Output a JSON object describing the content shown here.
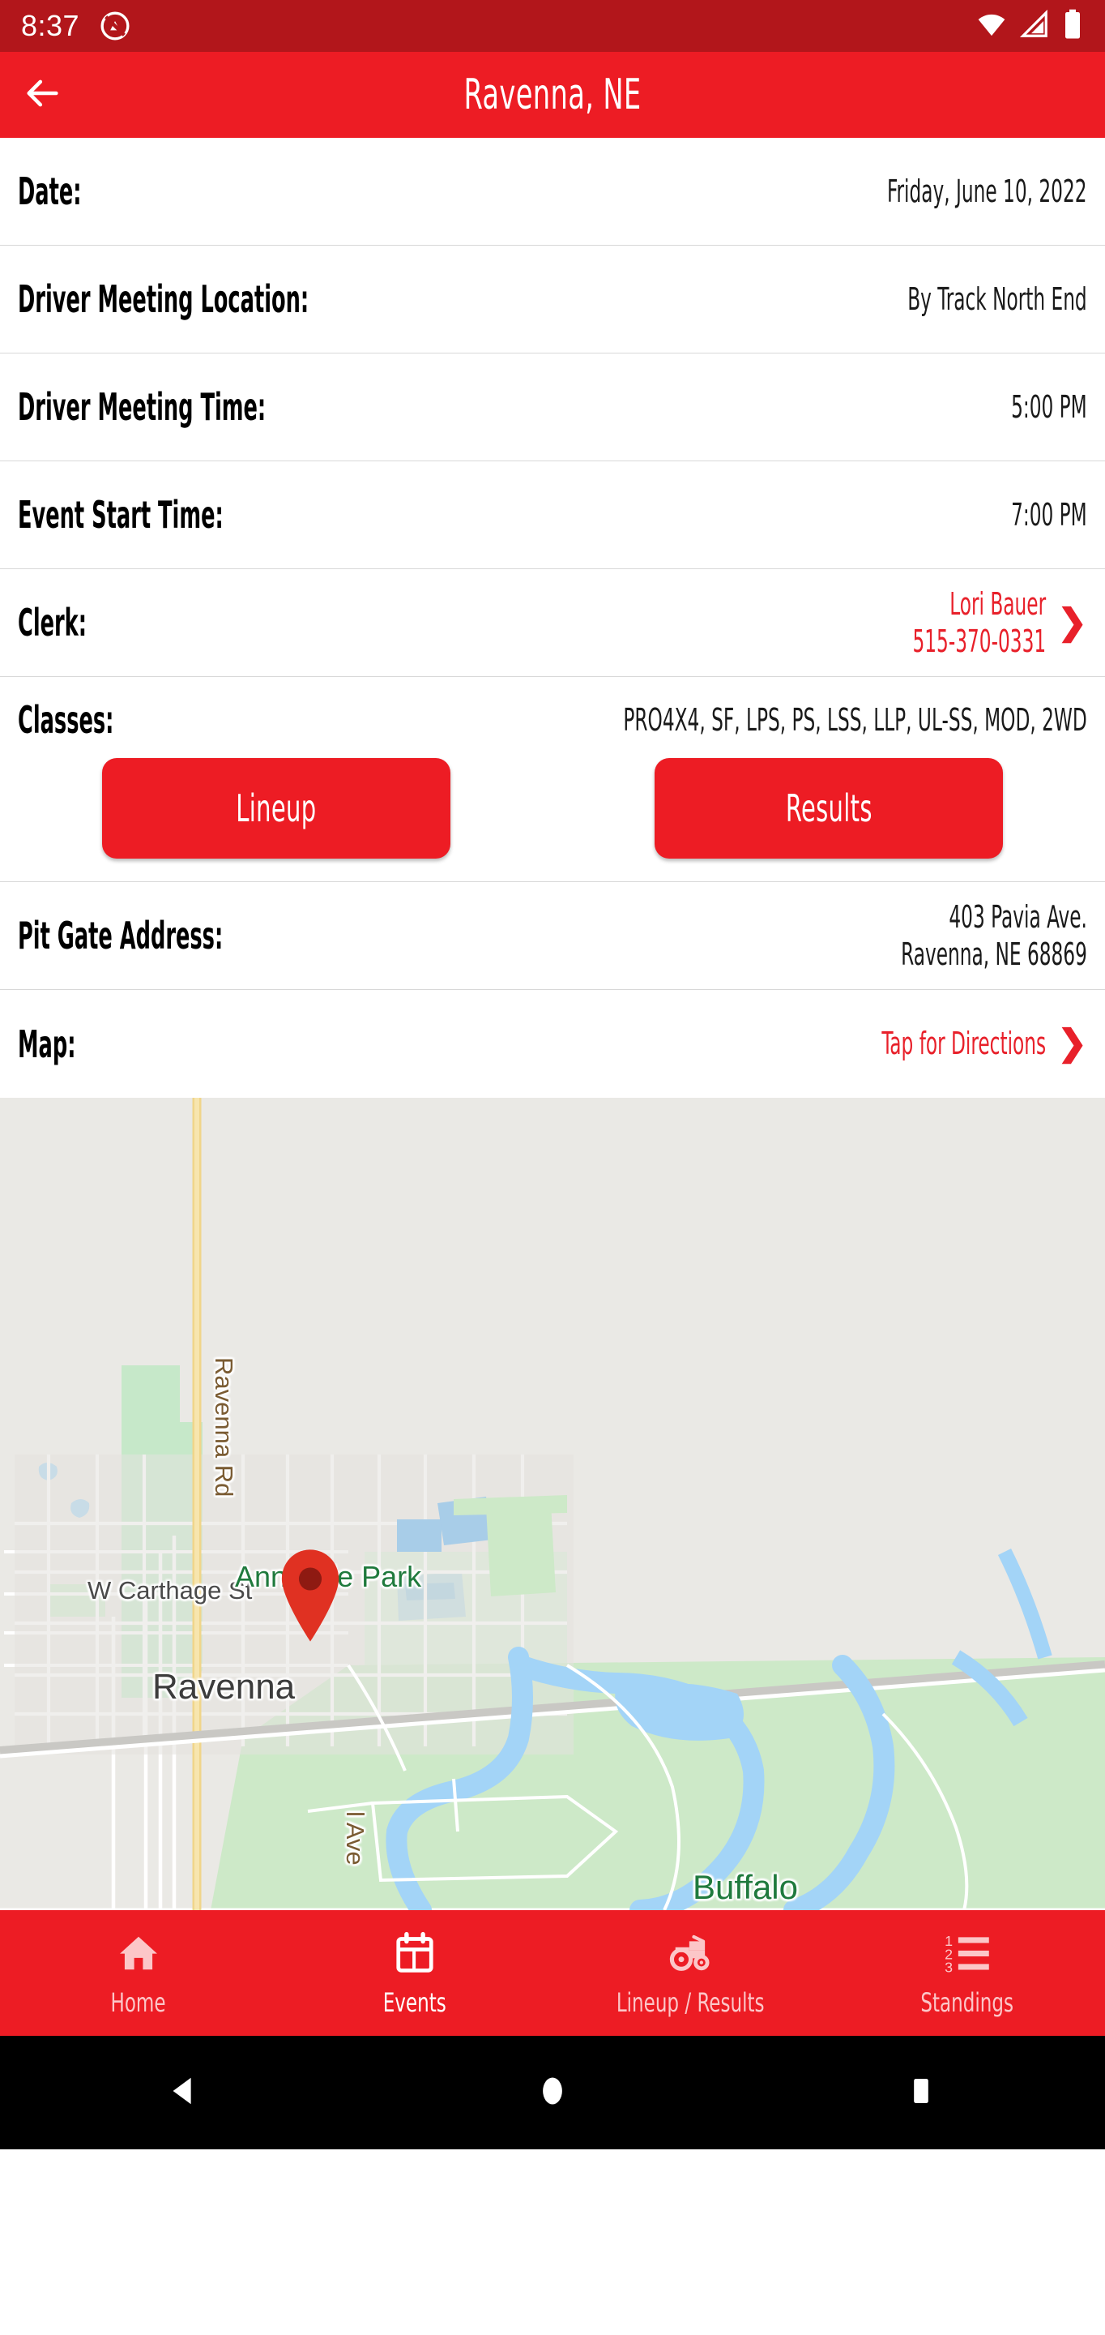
{
  "status_bar": {
    "time": "8:37",
    "notification_icon": "dnd-icon",
    "wifi_icon": "wifi-icon",
    "signal_icon": "cell-signal-icon",
    "battery_icon": "battery-icon",
    "background": "#B2161B"
  },
  "app_bar": {
    "title": "Ravenna, NE",
    "back_icon": "arrow-back-icon",
    "background": "#ED1C24"
  },
  "theme": {
    "accent": "#ED1C24",
    "link_red": "#E8202A",
    "text": "#1a1a1a"
  },
  "details": [
    {
      "label": "Date:",
      "value": "Friday, June 10, 2022"
    },
    {
      "label": "Driver Meeting Location:",
      "value": "By Track North End"
    },
    {
      "label": "Driver Meeting Time:",
      "value": "5:00 PM"
    },
    {
      "label": "Event Start Time:",
      "value": "7:00 PM"
    }
  ],
  "clerk": {
    "label": "Clerk:",
    "name": "Lori Bauer",
    "phone": "515-370-0331",
    "chevron": "❯"
  },
  "classes": {
    "label": "Classes:",
    "value": "PRO4X4, SF, LPS, PS, LSS, LLP, UL-SS, MOD, 2WD"
  },
  "actions": {
    "lineup_label": "Lineup",
    "results_label": "Results"
  },
  "pit_gate": {
    "label": "Pit Gate Address:",
    "line1": "403 Pavia Ave.",
    "line2": "Ravenna, NE 68869"
  },
  "map_row": {
    "label": "Map:",
    "link": "Tap for Directions",
    "chevron": "❯"
  },
  "map": {
    "pin_icon": "map-pin-icon",
    "pin_color": "#E03122",
    "labels": [
      {
        "text": "Ravenna Rd",
        "type": "road"
      },
      {
        "text": "W Carthage St",
        "type": "street"
      },
      {
        "text": "Ravenna",
        "type": "city"
      },
      {
        "text": "Anneville Park",
        "type": "park"
      },
      {
        "text": "Buffalo",
        "type": "park"
      },
      {
        "text": "l Ave",
        "type": "road"
      }
    ]
  },
  "bottom_nav": {
    "items": [
      {
        "label": "Home",
        "icon": "home-icon",
        "active": false
      },
      {
        "label": "Events",
        "icon": "calendar-icon",
        "active": true
      },
      {
        "label": "Lineup / Results",
        "icon": "tractor-icon",
        "active": false
      },
      {
        "label": "Standings",
        "icon": "ranked-list-icon",
        "active": false
      }
    ]
  },
  "system_nav": {
    "back_icon": "android-back-icon",
    "home_icon": "android-home-icon",
    "recents_icon": "android-recents-icon"
  }
}
